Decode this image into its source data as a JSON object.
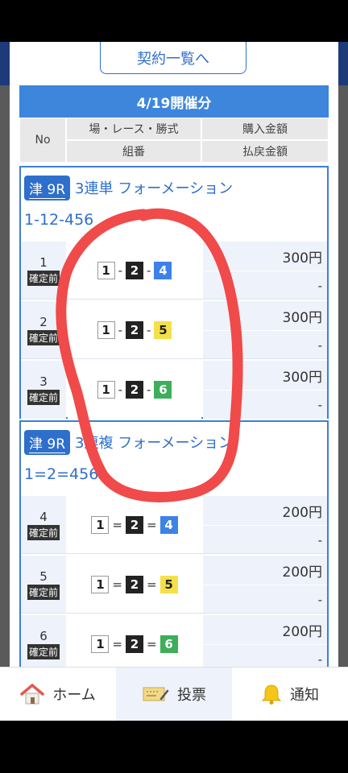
{
  "list_button_label": "契約一覧へ",
  "date_header": "4/19開催分",
  "table_header": {
    "no": "No",
    "venue_race_type": "場・レース・勝式",
    "purchase_amount": "購入金額",
    "combination": "組番",
    "payout_amount": "払戻金額"
  },
  "blocks": [
    {
      "venue": "津 9R",
      "bet_type": "3連単 フォーメーション",
      "formation": "1-12-456",
      "rows": [
        {
          "no": "1",
          "status": "確定前",
          "n1": "1",
          "sep1": "-",
          "n2": "2",
          "sep2": "-",
          "n3": "4",
          "amount": "300円",
          "payout": "-"
        },
        {
          "no": "2",
          "status": "確定前",
          "n1": "1",
          "sep1": "-",
          "n2": "2",
          "sep2": "-",
          "n3": "5",
          "amount": "300円",
          "payout": "-"
        },
        {
          "no": "3",
          "status": "確定前",
          "n1": "1",
          "sep1": "-",
          "n2": "2",
          "sep2": "-",
          "n3": "6",
          "amount": "300円",
          "payout": "-"
        }
      ]
    },
    {
      "venue": "津 9R",
      "bet_type": "3連複 フォーメーション",
      "formation": "1=2=456",
      "rows": [
        {
          "no": "4",
          "status": "確定前",
          "n1": "1",
          "sep1": "=",
          "n2": "2",
          "sep2": "=",
          "n3": "4",
          "amount": "200円",
          "payout": "-"
        },
        {
          "no": "5",
          "status": "確定前",
          "n1": "1",
          "sep1": "=",
          "n2": "2",
          "sep2": "=",
          "n3": "5",
          "amount": "200円",
          "payout": "-"
        },
        {
          "no": "6",
          "status": "確定前",
          "n1": "1",
          "sep1": "=",
          "n2": "2",
          "sep2": "=",
          "n3": "6",
          "amount": "200円",
          "payout": "-"
        }
      ]
    }
  ],
  "nav": {
    "home": "ホーム",
    "vote": "投票",
    "notify": "通知"
  },
  "colors": {
    "accent": "#3d86db",
    "boat_1": "#ffffff",
    "boat_2": "#222222",
    "boat_4": "#3c82e8",
    "boat_5": "#f5e04a",
    "boat_6": "#3fae5a",
    "scribble": "#f04a4a"
  },
  "icons": [
    "house-icon",
    "ticket-icon",
    "bell-icon"
  ]
}
